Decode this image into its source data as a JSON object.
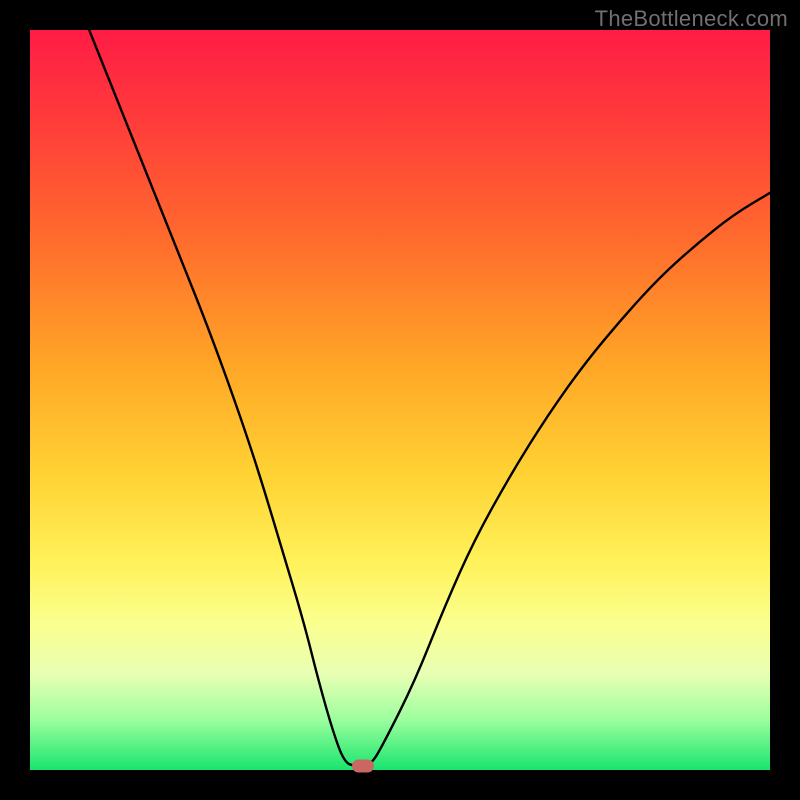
{
  "watermark": "TheBottleneck.com",
  "chart_data": {
    "type": "line",
    "title": "",
    "xlabel": "",
    "ylabel": "",
    "xlim": [
      0,
      100
    ],
    "ylim": [
      0,
      100
    ],
    "x": [
      8,
      12,
      16,
      20,
      24,
      28,
      31,
      34,
      37,
      39,
      41,
      42.5,
      44,
      46,
      48,
      52,
      56,
      60,
      65,
      70,
      75,
      80,
      85,
      90,
      95,
      100
    ],
    "values": [
      100,
      90,
      80,
      70,
      60,
      49,
      40,
      30,
      20,
      12,
      5,
      1,
      0.5,
      0.5,
      4,
      12,
      22,
      31,
      40,
      48,
      55,
      61,
      66.5,
      71,
      75,
      78
    ],
    "marker": {
      "x": 45,
      "y": 0.5
    },
    "background_gradient": {
      "top": "#ff1c45",
      "mid": "#ffd233",
      "bottom": "#19e56e"
    }
  }
}
